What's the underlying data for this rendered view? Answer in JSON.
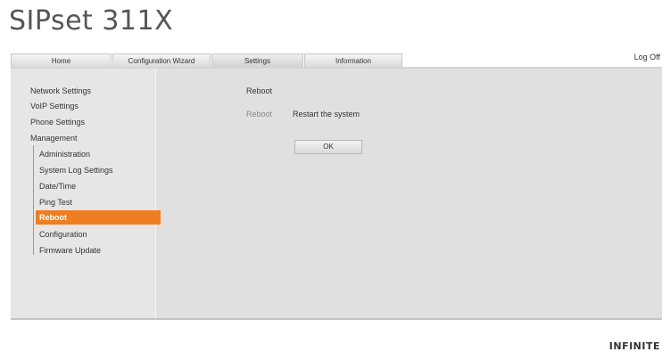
{
  "brand": "SIPset 311X",
  "tabs": [
    {
      "label": "Home"
    },
    {
      "label": "Configuration Wizard"
    },
    {
      "label": "Settings"
    },
    {
      "label": "Information"
    }
  ],
  "logoff": "Log Off",
  "sidebar": {
    "items": [
      {
        "label": "Network Settings"
      },
      {
        "label": "VoIP Settings"
      },
      {
        "label": "Phone Settings"
      },
      {
        "label": "Management"
      }
    ],
    "management_sub": [
      {
        "label": "Administration"
      },
      {
        "label": "System Log Settings"
      },
      {
        "label": "Date/Time"
      },
      {
        "label": "Ping Test"
      },
      {
        "label": "Reboot"
      },
      {
        "label": "Configuration"
      },
      {
        "label": "Firmware Update"
      }
    ]
  },
  "content": {
    "section_title": "Reboot",
    "row_label": "Reboot",
    "row_value": "Restart the system",
    "ok_label": "OK"
  },
  "footer_logo": "INFINITE",
  "colors": {
    "accent": "#ef7d22"
  }
}
